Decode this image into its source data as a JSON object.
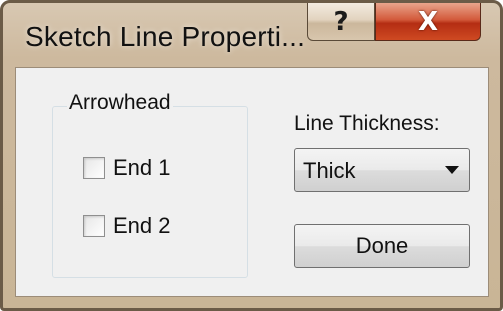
{
  "window": {
    "title": "Sketch Line Properti...",
    "help_glyph": "?",
    "close_glyph": "X"
  },
  "arrowhead": {
    "group_label": "Arrowhead",
    "options": [
      {
        "label": "End 1",
        "checked": false
      },
      {
        "label": "End 2",
        "checked": false
      }
    ]
  },
  "line_thickness": {
    "label": "Line Thickness:",
    "selected": "Thick"
  },
  "actions": {
    "done_label": "Done"
  },
  "icons": {
    "help": "help-icon",
    "close": "close-icon",
    "dropdown": "chevron-down-icon"
  },
  "colors": {
    "frame": "#c9b596",
    "close_button": "#c43a1a",
    "client_bg": "#f0f0f0"
  }
}
